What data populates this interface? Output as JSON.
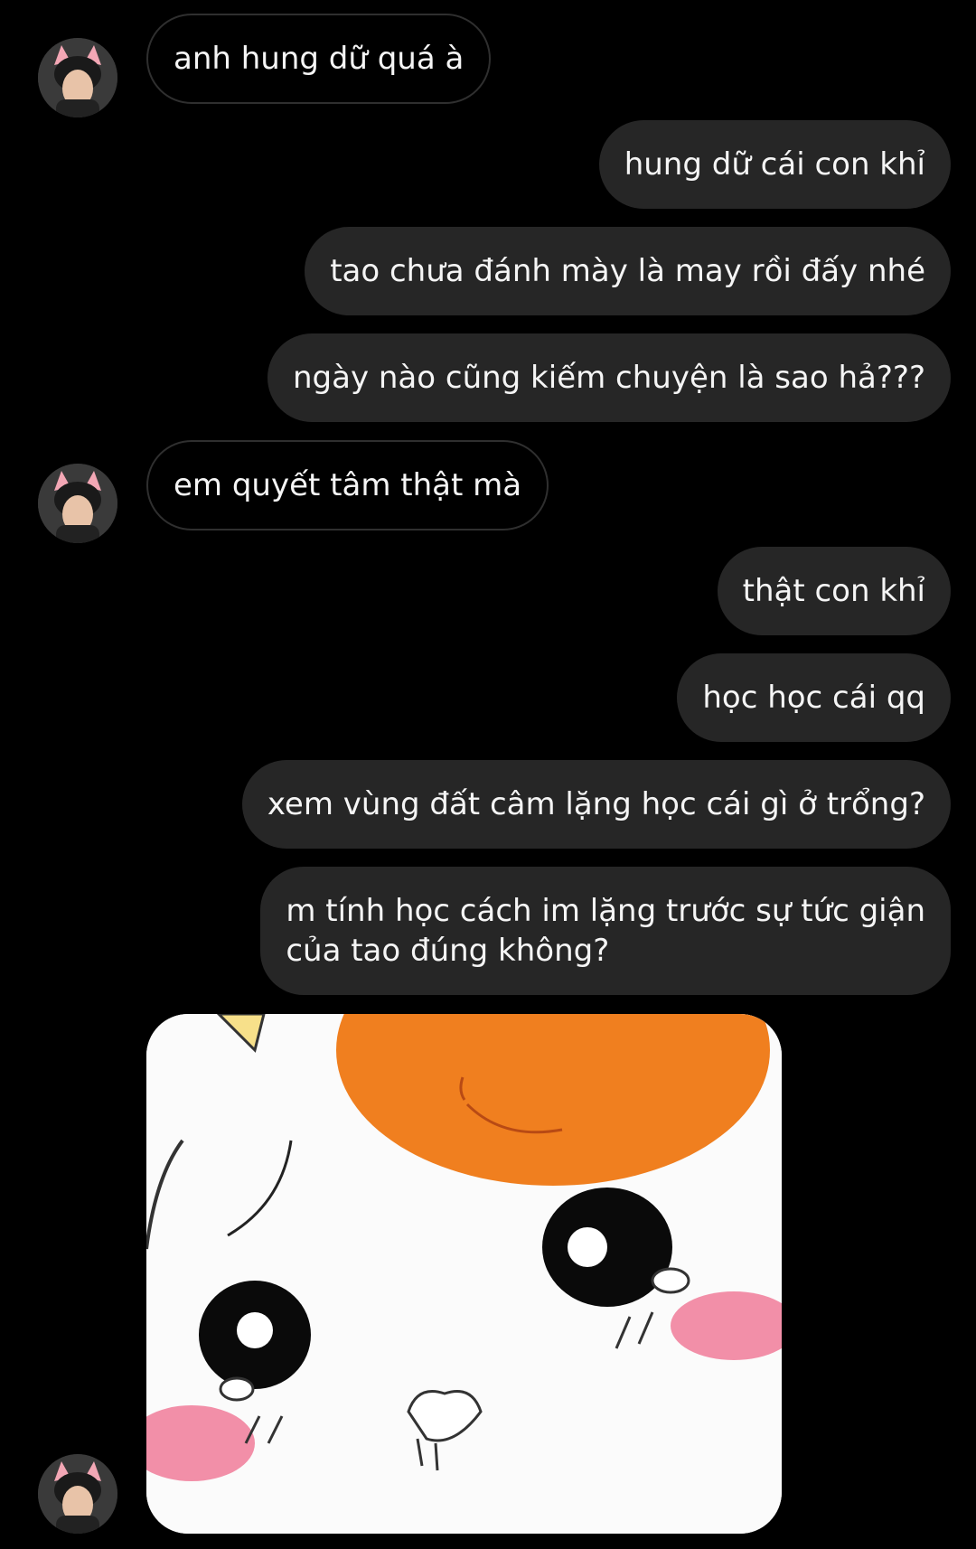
{
  "messages": [
    {
      "side": "in",
      "text": "anh hung dữ quá à"
    },
    {
      "side": "out",
      "text": "hung dữ cái con khỉ"
    },
    {
      "side": "out",
      "text": "tao chưa đánh mày là may rồi đấy nhé"
    },
    {
      "side": "out",
      "text": "ngày nào cũng kiếm chuyện là sao hả???"
    },
    {
      "side": "in",
      "text": "em quyết tâm thật mà"
    },
    {
      "side": "out",
      "text": "thật con khỉ"
    },
    {
      "side": "out",
      "text": "học học cái qq"
    },
    {
      "side": "out",
      "text": "xem vùng đất câm lặng học cái gì ở trổng?"
    },
    {
      "side": "out",
      "text": "m tính học cách im lặng trước sự tức giận\ncủa tao đúng không?"
    }
  ],
  "colors": {
    "background": "#000000",
    "outgoing_bubble": "#262626",
    "incoming_border": "#2f2f2f",
    "text": "#f5f5f5",
    "sticker_orange": "#f07f1f",
    "sticker_blush": "#f28fa8"
  },
  "sticker": {
    "icon": "hamster-sticker-icon"
  },
  "avatar": {
    "icon": "user-avatar-icon"
  }
}
